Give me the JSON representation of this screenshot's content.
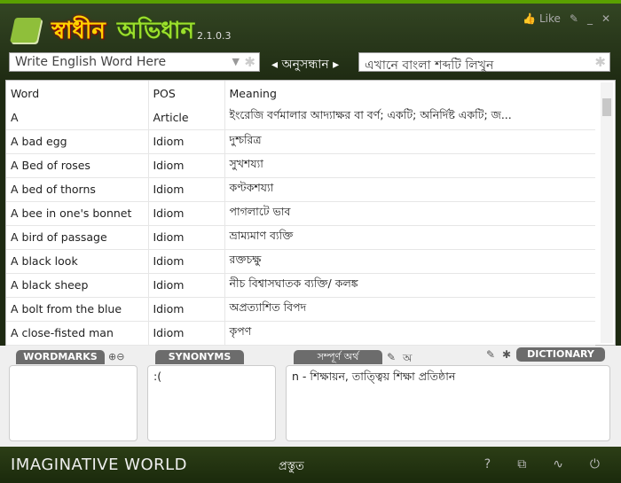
{
  "app": {
    "title_part1": "স্বাধীন",
    "title_part2": "অভিধান",
    "version": "2.1.0.3",
    "like": "Like"
  },
  "search": {
    "english_placeholder": "Write English Word Here",
    "label": "অনুসন্ধান",
    "bangla_placeholder": "এখানে বাংলা শব্দটি লিখুন"
  },
  "table": {
    "headers": [
      "Word",
      "POS",
      "Meaning"
    ],
    "rows": [
      [
        "A",
        "Article",
        "ইংরেজি বর্ণমালার আদ্যাক্ষর বা বর্ণ; একটি; অনির্দিষ্ট একটি; জ..."
      ],
      [
        "A bad egg",
        "Idiom",
        "দুশ্চরিত্র"
      ],
      [
        "A Bed of roses",
        "Idiom",
        "সুখশয্যা"
      ],
      [
        "A bed of thorns",
        "Idiom",
        "কণ্টকশয্যা"
      ],
      [
        "A bee in one's bonnet",
        "Idiom",
        "পাগলাটে ভাব"
      ],
      [
        "A bird of passage",
        "Idiom",
        "ভ্রাম্যমাণ ব্যক্তি"
      ],
      [
        "A black look",
        "Idiom",
        "রক্তচক্ষু"
      ],
      [
        "A black sheep",
        "Idiom",
        "নীচ বিশ্বাসঘাতক ব্যক্তি/ কলঙ্ক"
      ],
      [
        "A bolt from the blue",
        "Idiom",
        "অপ্রত্যাশিত বিপদ"
      ],
      [
        "A close-fisted man",
        "Idiom",
        "কৃপণ"
      ]
    ]
  },
  "panels": {
    "wordmarks": "WORDMARKS",
    "synonyms": "SYNONYMS",
    "synonyms_text": ":(",
    "full_meaning": "সম্পূর্ণ অর্থ",
    "lang_toggle": "অ",
    "dictionary": "DICTIONARY",
    "meaning_text": "n - শিক্ষায়ন, তাত্ত্বিয় শিক্ষা প্রতিষ্ঠান"
  },
  "status": {
    "brand": "IMAGINATIVE WORLD",
    "text": "প্রস্তুত",
    "help": "?"
  },
  "colors": {
    "accent": "#5aa000",
    "header_bg": "#2b3a18"
  }
}
